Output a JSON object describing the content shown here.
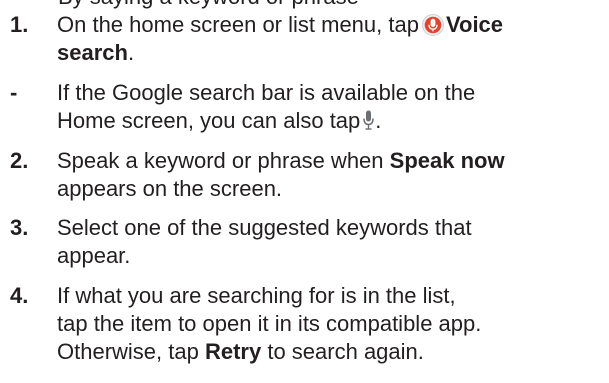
{
  "top_partial": "By saying a keyword or phrase",
  "steps": [
    {
      "marker": "1.",
      "l1_pre": "On the home screen or list menu, tap",
      "l1_bold": "Voice",
      "l2_bold": "search",
      "l2_post": ".",
      "icon": "voice-search-icon"
    },
    {
      "marker": "-",
      "l1": "If the Google search bar is available on the",
      "l2_pre": "Home screen, you can also tap",
      "l2_post": ".",
      "icon": "microphone-icon"
    },
    {
      "marker": "2.",
      "l1_pre": "Speak a keyword or phrase when",
      "l1_bold": "Speak now",
      "l2": "appears on the screen."
    },
    {
      "marker": "3.",
      "l1": "Select one of the suggested keywords that",
      "l2": "appear."
    },
    {
      "marker": "4.",
      "l1": "If what you are searching for is in the list,",
      "l2": "tap the item to open it in its compatible app.",
      "l3_pre": "Otherwise, tap",
      "l3_bold": "Retry",
      "l3_post": "to search again."
    }
  ],
  "colors": {
    "text": "#231f20",
    "voice_icon_red": "#e0452f",
    "voice_icon_ring": "#d4d4d4"
  }
}
